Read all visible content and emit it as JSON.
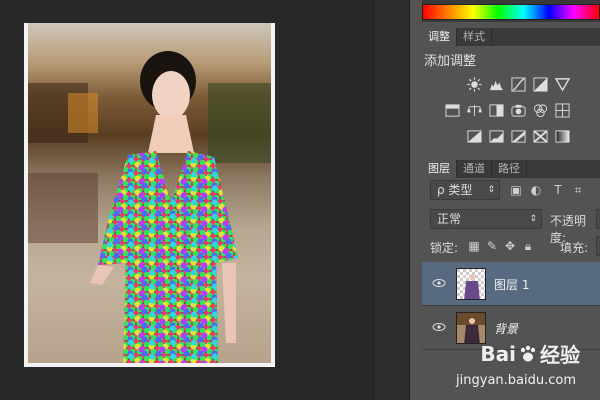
{
  "adjustments_panel": {
    "tabs": [
      {
        "label": "调整"
      },
      {
        "label": "样式"
      }
    ],
    "title": "添加调整",
    "icons": [
      "brightness-icon",
      "levels-icon",
      "curves-icon",
      "exposure-icon",
      "vibrance-icon",
      "hue-saturation-icon",
      "color-balance-icon",
      "black-white-icon",
      "photo-filter-icon",
      "channel-mixer-icon",
      "color-lookup-icon",
      "invert-icon",
      "posterize-icon",
      "threshold-icon",
      "selective-color-icon",
      "gradient-map-icon"
    ]
  },
  "layers_panel": {
    "tabs": [
      {
        "label": "图层"
      },
      {
        "label": "通道"
      },
      {
        "label": "路径"
      }
    ],
    "filter_kind": "ρ 类型",
    "blend_mode": "正常",
    "opacity_label": "不透明度:",
    "lock_label": "锁定:",
    "fill_label": "填充:",
    "layers": [
      {
        "name": "图层 1",
        "selected": true
      },
      {
        "name": "背景",
        "selected": false
      }
    ]
  },
  "watermark": {
    "brand": "Bai",
    "brand_suffix": "经验",
    "url": "jingyan.baidu.com"
  },
  "colors": {
    "panel_bg": "#535353",
    "workspace_bg": "#282828",
    "selected_layer": "#586a80"
  }
}
